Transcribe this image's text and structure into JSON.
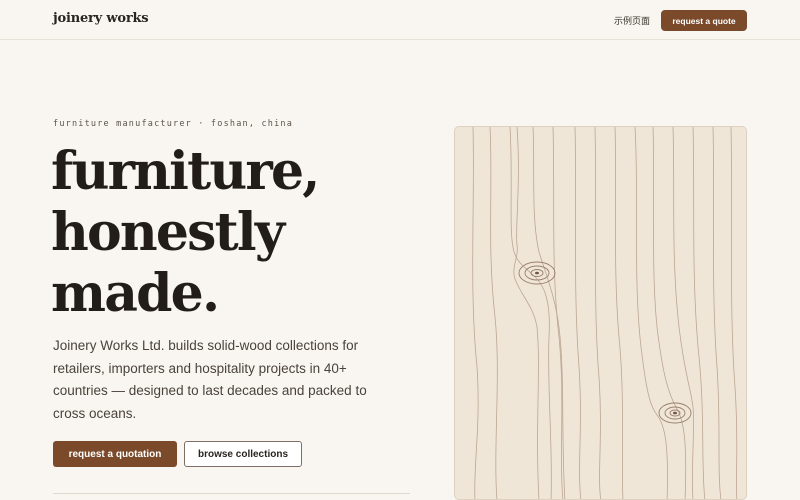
{
  "header": {
    "brand": "joinery works",
    "nav_link": "示例页面",
    "cta": "request a quote"
  },
  "hero": {
    "eyebrow": "furniture manufacturer · foshan, china",
    "headline": [
      "furniture,",
      "honestly",
      "made."
    ],
    "lede": "Joinery Works Ltd. builds solid-wood collections for retailers, importers and hospitality projects in 40+ countries — designed to last decades and packed to cross oceans.",
    "primary_button": "request a quotation",
    "secondary_button": "browse collections"
  },
  "colors": {
    "background": "#f9f6f1",
    "accent": "#7a4a2a",
    "text": "#231d19",
    "wood": "#efe6d8",
    "grain": "#b49a86"
  },
  "icons": {
    "wood_illustration": "wood-grain-illustration"
  }
}
